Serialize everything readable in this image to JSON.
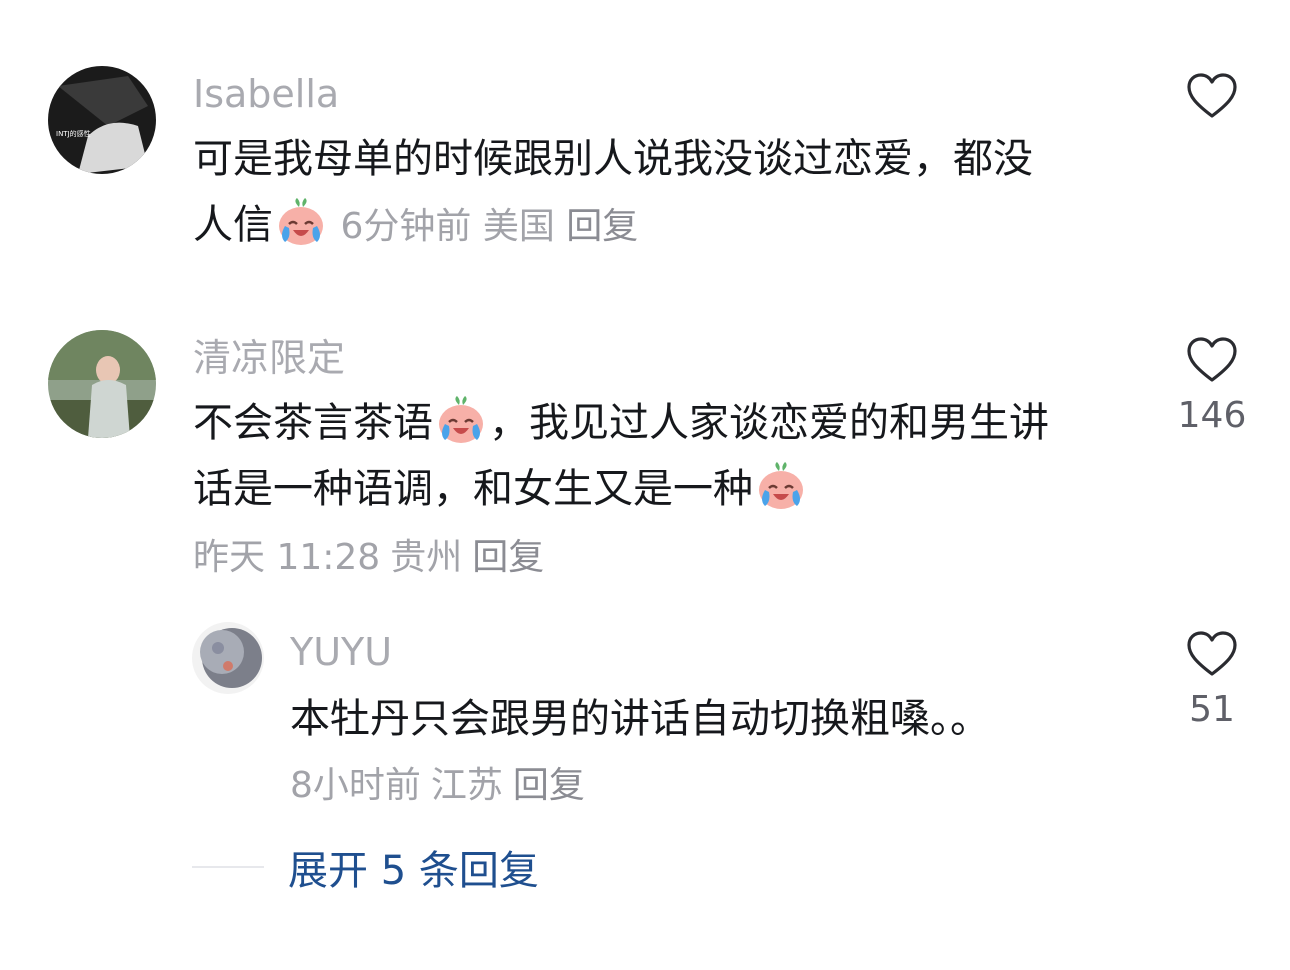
{
  "comments": [
    {
      "username": "Isabella",
      "text_line1": "可是我母单的时候跟别人说我没谈过恋爱，都没",
      "text_line2": "人信",
      "time": "6分钟前",
      "location": "美国",
      "reply_label": "回复",
      "avatar_text": "INTJ的感性",
      "likes": ""
    },
    {
      "username": "清凉限定",
      "text_line1_a": "不会茶言茶语",
      "text_line1_b": "，我见过人家谈恋爱的和男生讲",
      "text_line2": "话是一种语调，和女生又是一种",
      "time": "昨天 11:28",
      "location": "贵州",
      "reply_label": "回复",
      "likes": "146"
    }
  ],
  "reply": {
    "username": "YUYU",
    "text": "本牡丹只会跟男的讲话自动切换粗嗓。。",
    "time": "8小时前",
    "location": "江苏",
    "reply_label": "回复",
    "likes": "51"
  },
  "expand_label": "展开 5 条回复",
  "colors": {
    "username": "#a9aab0",
    "text": "#16181c",
    "meta": "#a2a3a9",
    "expand": "#1f4f8f"
  },
  "icons": [
    "heart-outline-icon",
    "crying-laughing-emoji"
  ]
}
